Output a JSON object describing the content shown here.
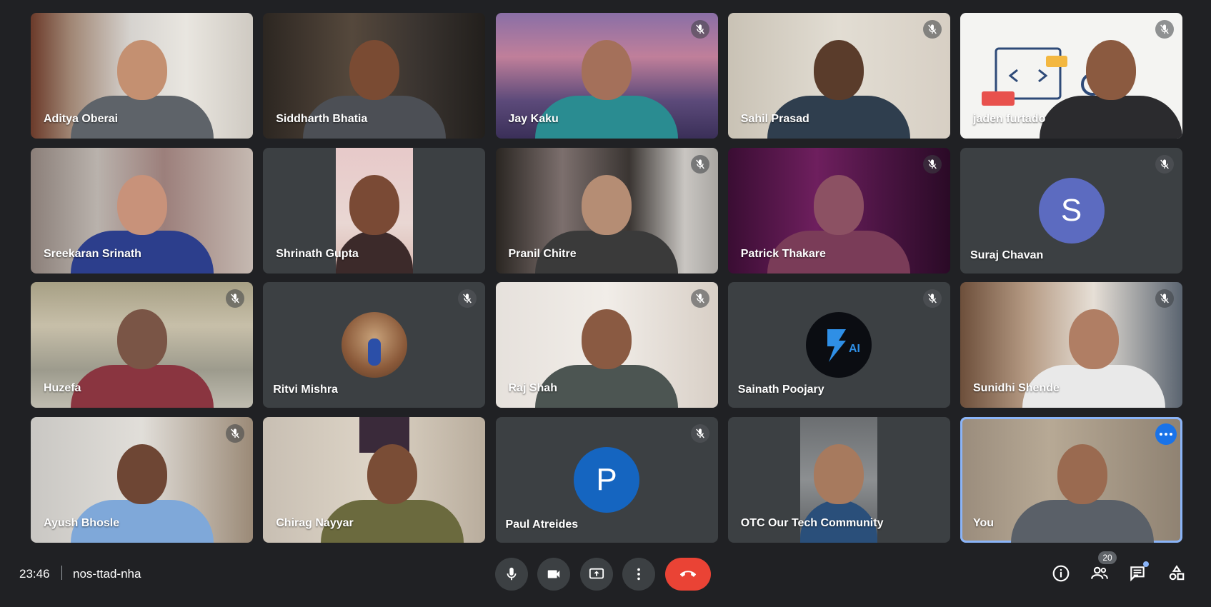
{
  "participants": [
    {
      "name": "Aditya Oberai",
      "muted": false
    },
    {
      "name": "Siddharth Bhatia",
      "muted": false
    },
    {
      "name": "Jay Kaku",
      "muted": true
    },
    {
      "name": "Sahil Prasad",
      "muted": true
    },
    {
      "name": "jaden furtado",
      "muted": true
    },
    {
      "name": "Sreekaran Srinath",
      "muted": false
    },
    {
      "name": "Shrinath Gupta",
      "muted": false
    },
    {
      "name": "Pranil Chitre",
      "muted": true
    },
    {
      "name": "Patrick Thakare",
      "muted": true
    },
    {
      "name": "Suraj Chavan",
      "muted": true,
      "avatar_letter": "S",
      "avatar_color": "#5c6bc0"
    },
    {
      "name": "Huzefa",
      "muted": true
    },
    {
      "name": "Ritvi Mishra",
      "muted": true
    },
    {
      "name": "Raj Shah",
      "muted": true
    },
    {
      "name": "Sainath Poojary",
      "muted": true,
      "avatar_letter": "AI"
    },
    {
      "name": "Sunidhi Shende",
      "muted": true
    },
    {
      "name": "Ayush Bhosle",
      "muted": true
    },
    {
      "name": "Chirag Nayyar",
      "muted": false
    },
    {
      "name": "Paul Atreides",
      "muted": true,
      "avatar_letter": "P",
      "avatar_color": "#1565c0"
    },
    {
      "name": "OTC Our Tech Community",
      "muted": false
    },
    {
      "name": "You",
      "muted": false
    }
  ],
  "bottom_bar": {
    "time": "23:46",
    "meeting_code": "nos-ttad-nha",
    "people_count": "20"
  },
  "colors": {
    "background": "#202124",
    "leave_button": "#ea4335",
    "accent": "#1a73e8"
  },
  "icons": {
    "mute": "mic-off-icon",
    "mic": "mic-icon",
    "camera": "videocam-icon",
    "present": "present-screen-icon",
    "more": "more-vert-icon",
    "leave": "call-end-icon",
    "info": "info-icon",
    "people": "people-icon",
    "chat": "chat-icon",
    "activities": "activities-icon"
  }
}
